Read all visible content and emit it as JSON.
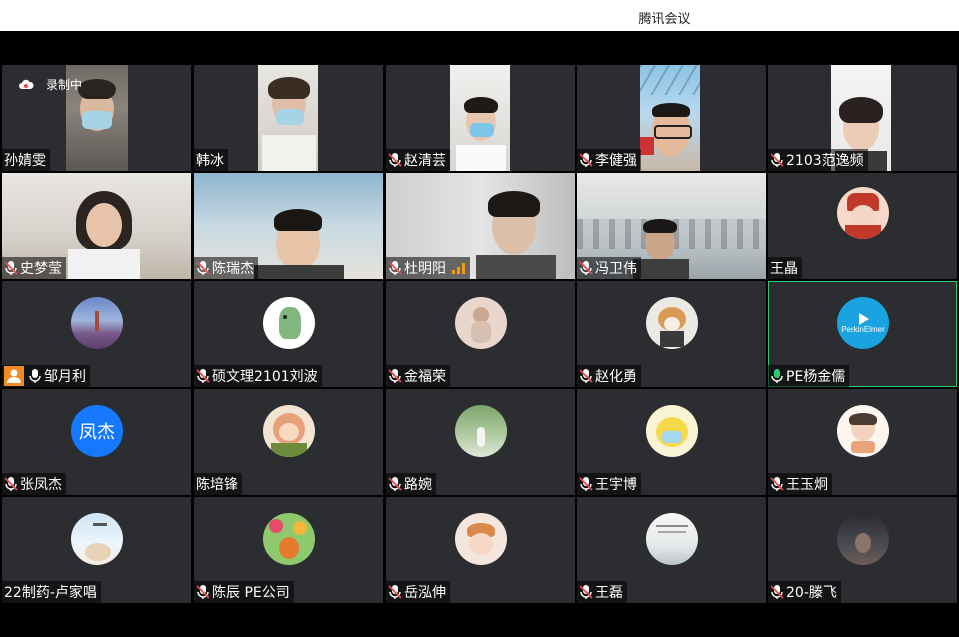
{
  "window": {
    "title": "腾讯会议"
  },
  "recording": {
    "label": "录制中"
  },
  "colors": {
    "accent_green": "#2ecc71",
    "tile_bg": "#2b2d31",
    "mic_muted": "#e84a4a"
  },
  "participants": [
    {
      "name": "孙婧雯",
      "video": true,
      "mic": "none"
    },
    {
      "name": "韩冰",
      "video": true,
      "mic": "none"
    },
    {
      "name": "赵清芸",
      "video": true,
      "mic": "muted"
    },
    {
      "name": "李健强",
      "video": true,
      "mic": "muted"
    },
    {
      "name": "2103范逸频",
      "video": true,
      "mic": "muted"
    },
    {
      "name": "史梦莹",
      "video": true,
      "mic": "muted"
    },
    {
      "name": "陈瑞杰",
      "video": true,
      "mic": "muted"
    },
    {
      "name": "杜明阳",
      "video": true,
      "mic": "muted",
      "signal": true
    },
    {
      "name": "冯卫伟",
      "video": true,
      "mic": "muted"
    },
    {
      "name": "王晶",
      "video": false,
      "mic": "none"
    },
    {
      "name": "邹月利",
      "video": false,
      "mic": "host"
    },
    {
      "name": "硕文理2101刘波",
      "video": false,
      "mic": "muted"
    },
    {
      "name": "金福荣",
      "video": false,
      "mic": "muted"
    },
    {
      "name": "赵化勇",
      "video": false,
      "mic": "muted"
    },
    {
      "name": "PE杨金儒",
      "video": false,
      "mic": "active",
      "speaking": true
    },
    {
      "name": "张凤杰",
      "video": false,
      "mic": "muted",
      "avatar_text": "凤杰"
    },
    {
      "name": "陈培锋",
      "video": false,
      "mic": "none"
    },
    {
      "name": "路婉",
      "video": false,
      "mic": "muted"
    },
    {
      "name": "王宇博",
      "video": false,
      "mic": "muted"
    },
    {
      "name": "王玉炯",
      "video": false,
      "mic": "muted"
    },
    {
      "name": "22制药-卢家唱",
      "video": false,
      "mic": "none"
    },
    {
      "name": "陈辰 PE公司",
      "video": false,
      "mic": "muted"
    },
    {
      "name": "岳泓伸",
      "video": false,
      "mic": "muted"
    },
    {
      "name": "王磊",
      "video": false,
      "mic": "muted"
    },
    {
      "name": "20-滕飞",
      "video": false,
      "mic": "muted"
    }
  ]
}
